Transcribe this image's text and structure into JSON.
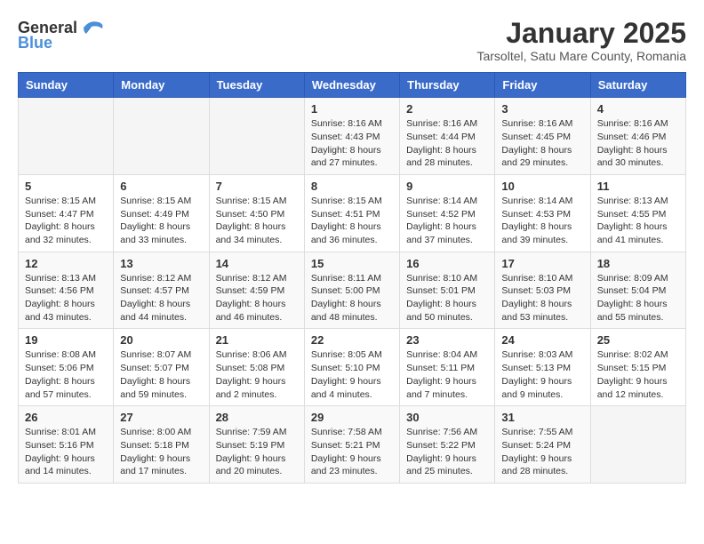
{
  "header": {
    "logo_general": "General",
    "logo_blue": "Blue",
    "month_title": "January 2025",
    "subtitle": "Tarsoltel, Satu Mare County, Romania"
  },
  "days_of_week": [
    "Sunday",
    "Monday",
    "Tuesday",
    "Wednesday",
    "Thursday",
    "Friday",
    "Saturday"
  ],
  "weeks": [
    [
      {
        "day": "",
        "info": ""
      },
      {
        "day": "",
        "info": ""
      },
      {
        "day": "",
        "info": ""
      },
      {
        "day": "1",
        "info": "Sunrise: 8:16 AM\nSunset: 4:43 PM\nDaylight: 8 hours and 27 minutes."
      },
      {
        "day": "2",
        "info": "Sunrise: 8:16 AM\nSunset: 4:44 PM\nDaylight: 8 hours and 28 minutes."
      },
      {
        "day": "3",
        "info": "Sunrise: 8:16 AM\nSunset: 4:45 PM\nDaylight: 8 hours and 29 minutes."
      },
      {
        "day": "4",
        "info": "Sunrise: 8:16 AM\nSunset: 4:46 PM\nDaylight: 8 hours and 30 minutes."
      }
    ],
    [
      {
        "day": "5",
        "info": "Sunrise: 8:15 AM\nSunset: 4:47 PM\nDaylight: 8 hours and 32 minutes."
      },
      {
        "day": "6",
        "info": "Sunrise: 8:15 AM\nSunset: 4:49 PM\nDaylight: 8 hours and 33 minutes."
      },
      {
        "day": "7",
        "info": "Sunrise: 8:15 AM\nSunset: 4:50 PM\nDaylight: 8 hours and 34 minutes."
      },
      {
        "day": "8",
        "info": "Sunrise: 8:15 AM\nSunset: 4:51 PM\nDaylight: 8 hours and 36 minutes."
      },
      {
        "day": "9",
        "info": "Sunrise: 8:14 AM\nSunset: 4:52 PM\nDaylight: 8 hours and 37 minutes."
      },
      {
        "day": "10",
        "info": "Sunrise: 8:14 AM\nSunset: 4:53 PM\nDaylight: 8 hours and 39 minutes."
      },
      {
        "day": "11",
        "info": "Sunrise: 8:13 AM\nSunset: 4:55 PM\nDaylight: 8 hours and 41 minutes."
      }
    ],
    [
      {
        "day": "12",
        "info": "Sunrise: 8:13 AM\nSunset: 4:56 PM\nDaylight: 8 hours and 43 minutes."
      },
      {
        "day": "13",
        "info": "Sunrise: 8:12 AM\nSunset: 4:57 PM\nDaylight: 8 hours and 44 minutes."
      },
      {
        "day": "14",
        "info": "Sunrise: 8:12 AM\nSunset: 4:59 PM\nDaylight: 8 hours and 46 minutes."
      },
      {
        "day": "15",
        "info": "Sunrise: 8:11 AM\nSunset: 5:00 PM\nDaylight: 8 hours and 48 minutes."
      },
      {
        "day": "16",
        "info": "Sunrise: 8:10 AM\nSunset: 5:01 PM\nDaylight: 8 hours and 50 minutes."
      },
      {
        "day": "17",
        "info": "Sunrise: 8:10 AM\nSunset: 5:03 PM\nDaylight: 8 hours and 53 minutes."
      },
      {
        "day": "18",
        "info": "Sunrise: 8:09 AM\nSunset: 5:04 PM\nDaylight: 8 hours and 55 minutes."
      }
    ],
    [
      {
        "day": "19",
        "info": "Sunrise: 8:08 AM\nSunset: 5:06 PM\nDaylight: 8 hours and 57 minutes."
      },
      {
        "day": "20",
        "info": "Sunrise: 8:07 AM\nSunset: 5:07 PM\nDaylight: 8 hours and 59 minutes."
      },
      {
        "day": "21",
        "info": "Sunrise: 8:06 AM\nSunset: 5:08 PM\nDaylight: 9 hours and 2 minutes."
      },
      {
        "day": "22",
        "info": "Sunrise: 8:05 AM\nSunset: 5:10 PM\nDaylight: 9 hours and 4 minutes."
      },
      {
        "day": "23",
        "info": "Sunrise: 8:04 AM\nSunset: 5:11 PM\nDaylight: 9 hours and 7 minutes."
      },
      {
        "day": "24",
        "info": "Sunrise: 8:03 AM\nSunset: 5:13 PM\nDaylight: 9 hours and 9 minutes."
      },
      {
        "day": "25",
        "info": "Sunrise: 8:02 AM\nSunset: 5:15 PM\nDaylight: 9 hours and 12 minutes."
      }
    ],
    [
      {
        "day": "26",
        "info": "Sunrise: 8:01 AM\nSunset: 5:16 PM\nDaylight: 9 hours and 14 minutes."
      },
      {
        "day": "27",
        "info": "Sunrise: 8:00 AM\nSunset: 5:18 PM\nDaylight: 9 hours and 17 minutes."
      },
      {
        "day": "28",
        "info": "Sunrise: 7:59 AM\nSunset: 5:19 PM\nDaylight: 9 hours and 20 minutes."
      },
      {
        "day": "29",
        "info": "Sunrise: 7:58 AM\nSunset: 5:21 PM\nDaylight: 9 hours and 23 minutes."
      },
      {
        "day": "30",
        "info": "Sunrise: 7:56 AM\nSunset: 5:22 PM\nDaylight: 9 hours and 25 minutes."
      },
      {
        "day": "31",
        "info": "Sunrise: 7:55 AM\nSunset: 5:24 PM\nDaylight: 9 hours and 28 minutes."
      },
      {
        "day": "",
        "info": ""
      }
    ]
  ]
}
